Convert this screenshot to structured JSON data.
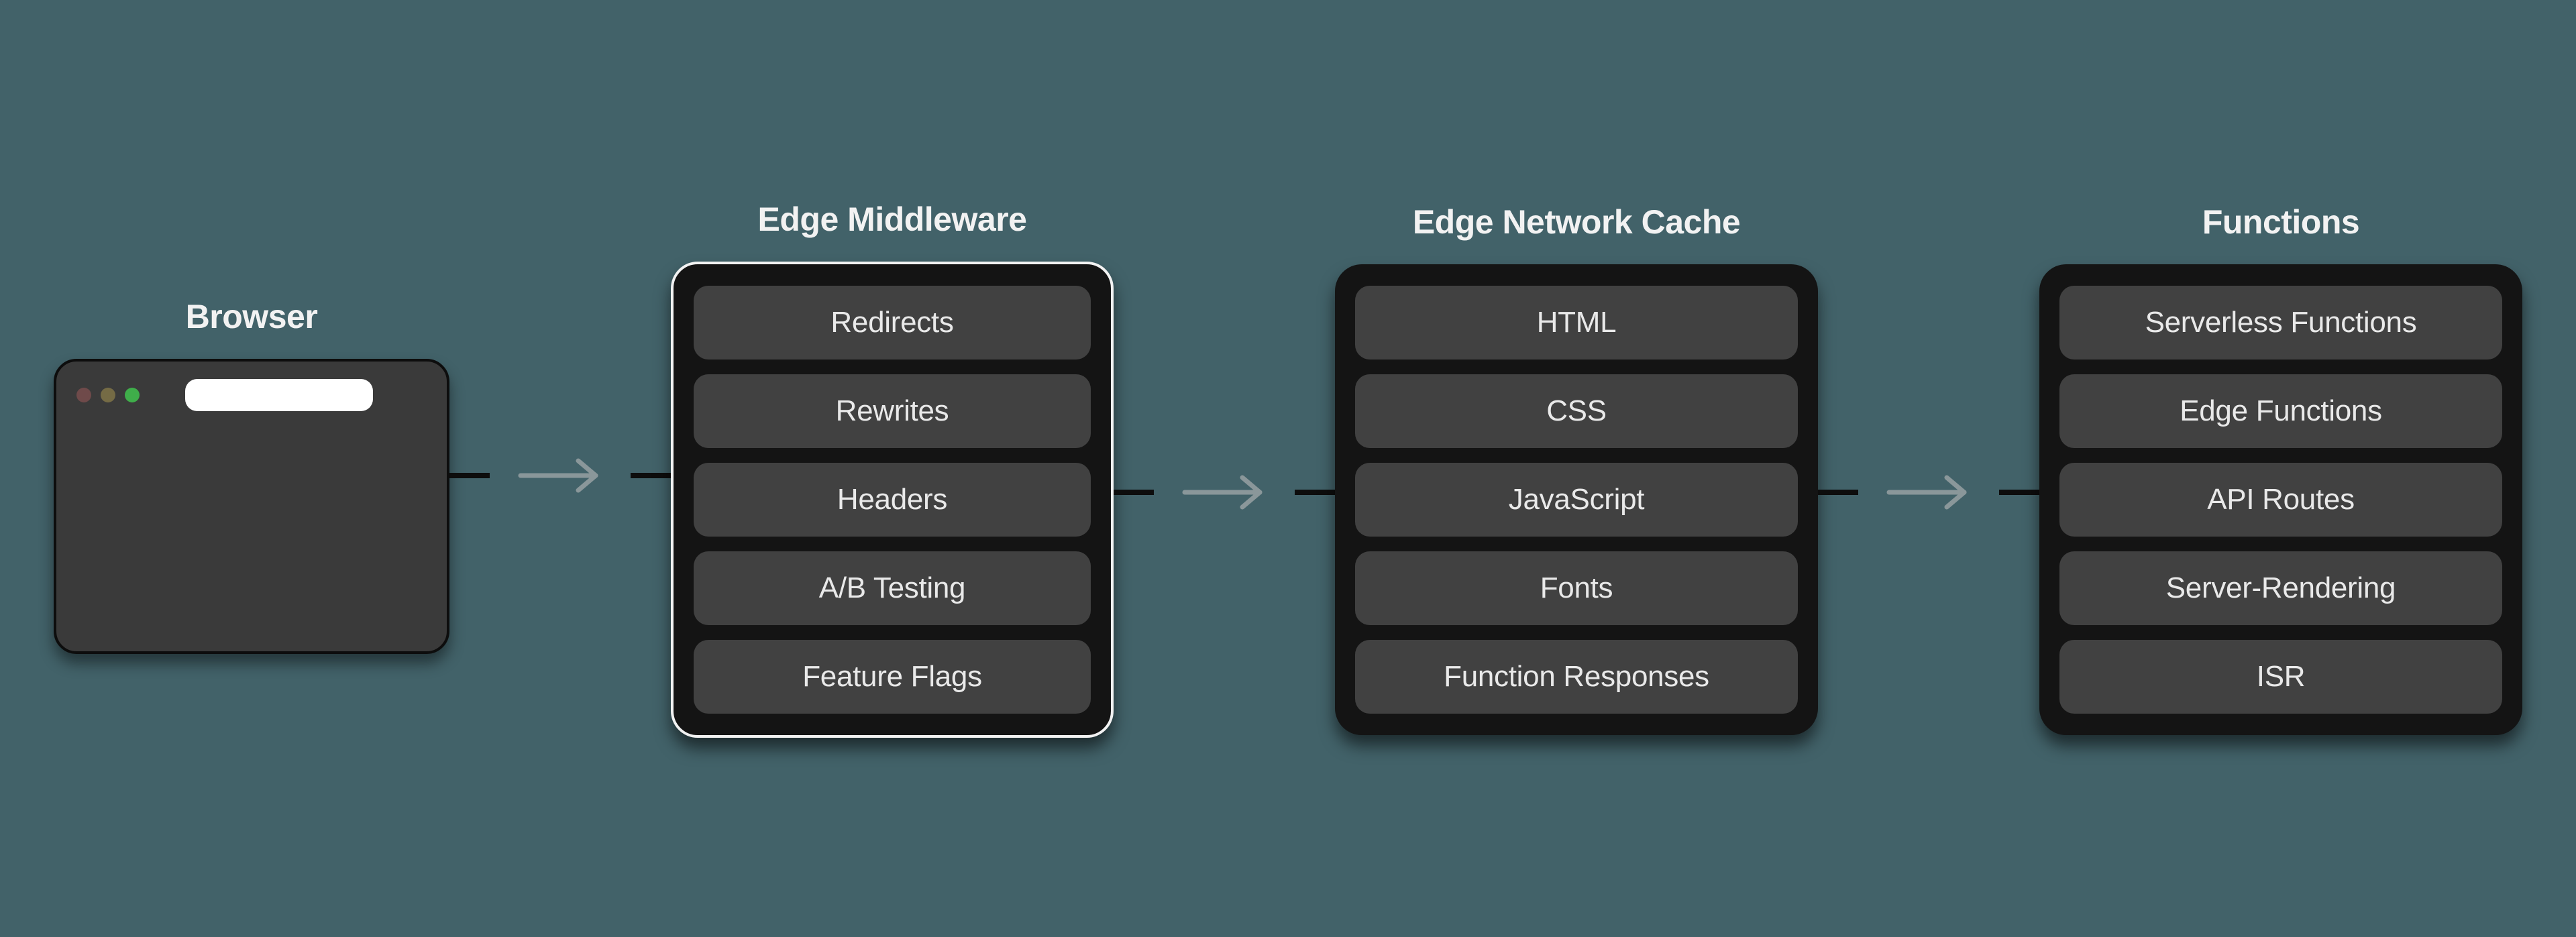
{
  "browser": {
    "title": "Browser"
  },
  "arrows": [
    "→",
    "→",
    "→"
  ],
  "columns": [
    {
      "title": "Edge Middleware",
      "highlighted": true,
      "items": [
        "Redirects",
        "Rewrites",
        "Headers",
        "A/B Testing",
        "Feature Flags"
      ]
    },
    {
      "title": "Edge Network Cache",
      "highlighted": false,
      "items": [
        "HTML",
        "CSS",
        "JavaScript",
        "Fonts",
        "Function Responses"
      ]
    },
    {
      "title": "Functions",
      "highlighted": false,
      "items": [
        "Serverless Functions",
        "Edge Functions",
        "API Routes",
        "Server-Rendering",
        "ISR"
      ]
    }
  ]
}
